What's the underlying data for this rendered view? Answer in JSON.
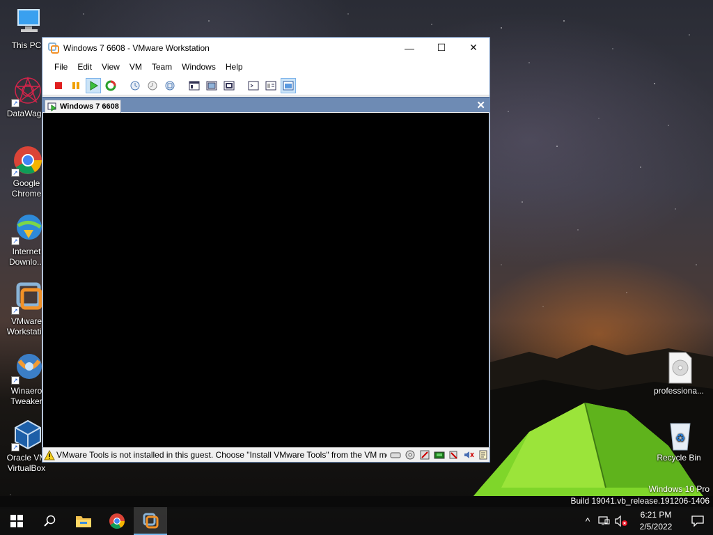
{
  "desktop": {
    "icons_left": [
      {
        "label": "This PC",
        "icon": "computer-icon"
      },
      {
        "label": "DataWago",
        "icon": "datawago-icon"
      },
      {
        "label": "Google Chrome",
        "icon": "chrome-icon"
      },
      {
        "label": "Internet Downlo...",
        "icon": "idm-icon"
      },
      {
        "label": "VMware Workstatio",
        "icon": "vmware-icon"
      },
      {
        "label": "Winaero Tweaker",
        "icon": "winaero-icon"
      },
      {
        "label": "Oracle VM VirtualBox",
        "icon": "virtualbox-icon"
      }
    ],
    "icons_right": [
      {
        "label": "professiona...",
        "icon": "disc-image-icon"
      },
      {
        "label": "Recycle Bin",
        "icon": "recycle-bin-icon"
      }
    ],
    "watermark": {
      "line1": "Windows 10 Pro",
      "line2": "Build 19041.vb_release.191206-1406"
    }
  },
  "vmware": {
    "title": "Windows 7 6608 - VMware Workstation",
    "window_controls": {
      "minimize": "—",
      "maximize": "☐",
      "close": "✕"
    },
    "menu": [
      "File",
      "Edit",
      "View",
      "VM",
      "Team",
      "Windows",
      "Help"
    ],
    "toolbar": [
      {
        "icon": "power-off-icon"
      },
      {
        "icon": "suspend-icon"
      },
      {
        "icon": "power-on-icon",
        "active": true
      },
      {
        "icon": "reset-icon"
      },
      {
        "icon": "snapshot-take-icon"
      },
      {
        "icon": "snapshot-revert-icon"
      },
      {
        "icon": "snapshot-manager-icon"
      },
      {
        "icon": "summary-view-icon"
      },
      {
        "icon": "fullscreen-icon"
      },
      {
        "icon": "quick-switch-icon"
      },
      {
        "icon": "console-view-icon"
      },
      {
        "icon": "appliance-view-icon"
      },
      {
        "icon": "unity-view-icon",
        "active": true
      }
    ],
    "tab": {
      "label": "Windows 7 6608",
      "close": "✕"
    },
    "status": {
      "message": "VMware Tools is not installed in this guest. Choose \"Install VMware Tools\" from the VM me",
      "devices": [
        "hard-disk-icon",
        "cd-rom-icon",
        "floppy-icon",
        "network-icon",
        "usb-icon",
        "sound-icon",
        "message-log-icon"
      ]
    }
  },
  "taskbar": {
    "apps": [
      {
        "icon": "start-icon"
      },
      {
        "icon": "search-icon"
      },
      {
        "icon": "file-explorer-icon"
      },
      {
        "icon": "chrome-icon"
      },
      {
        "icon": "vmware-icon",
        "active": true
      }
    ],
    "tray": {
      "chevron": "^",
      "time": "6:21 PM",
      "date": "2/5/2022"
    }
  },
  "colors": {
    "tab_bar": "#6e8bb4",
    "accent": "#76b9ed",
    "vm_console": "#000000"
  }
}
